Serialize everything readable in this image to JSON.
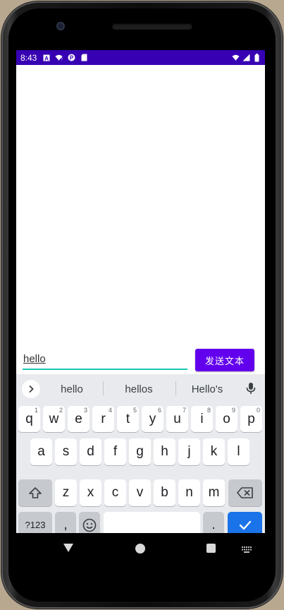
{
  "status_bar": {
    "time": "8:43",
    "left_icons": [
      "a-icon",
      "wifi-question-icon",
      "p-icon",
      "sd-card-icon"
    ],
    "right_icons": [
      "wifi-icon",
      "signal-icon",
      "battery-icon"
    ],
    "color": "#3700b3"
  },
  "message_input": {
    "value": "hello",
    "underline_color": "#1bc7b5"
  },
  "send_button": {
    "label": "发送文本",
    "color": "#6200ee"
  },
  "keyboard": {
    "suggestions": [
      "hello",
      "hellos",
      "Hello's"
    ],
    "row1": [
      {
        "k": "q",
        "h": "1"
      },
      {
        "k": "w",
        "h": "2"
      },
      {
        "k": "e",
        "h": "3"
      },
      {
        "k": "r",
        "h": "4"
      },
      {
        "k": "t",
        "h": "5"
      },
      {
        "k": "y",
        "h": "6"
      },
      {
        "k": "u",
        "h": "7"
      },
      {
        "k": "i",
        "h": "8"
      },
      {
        "k": "o",
        "h": "9"
      },
      {
        "k": "p",
        "h": "0"
      }
    ],
    "row2": [
      "a",
      "s",
      "d",
      "f",
      "g",
      "h",
      "j",
      "k",
      "l"
    ],
    "row3": [
      "z",
      "x",
      "c",
      "v",
      "b",
      "n",
      "m"
    ],
    "symbols_label": "?123",
    "comma_label": ",",
    "period_label": ".",
    "enter_color": "#1a73e8"
  },
  "navigation": {
    "icons": [
      "back-icon",
      "home-icon",
      "recents-icon",
      "keyboard-switch-icon"
    ]
  }
}
